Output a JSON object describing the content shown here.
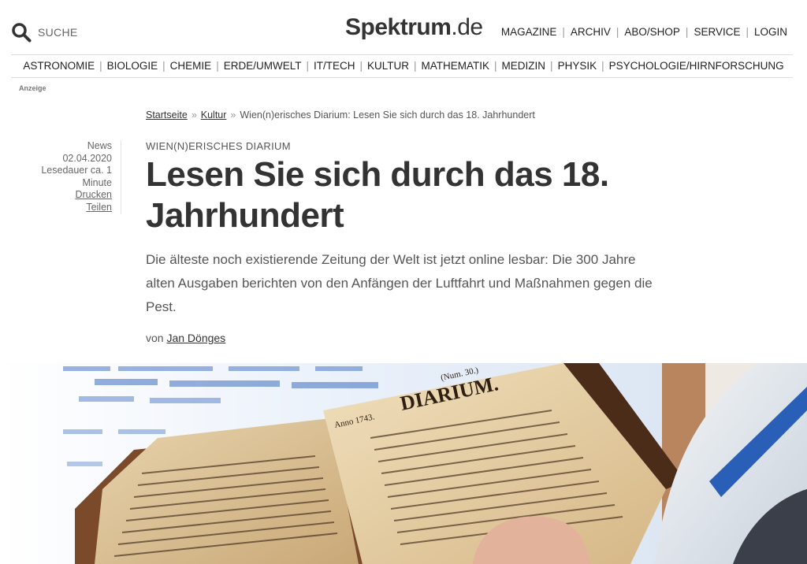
{
  "header": {
    "search_label": "SUCHE",
    "logo_main": "Spektrum",
    "logo_domain": ".de",
    "nav": [
      "MAGAZINE",
      "ARCHIV",
      "ABO/SHOP",
      "SERVICE",
      "LOGIN"
    ]
  },
  "categories": [
    "ASTRONOMIE",
    "BIOLOGIE",
    "CHEMIE",
    "ERDE/UMWELT",
    "IT/TECH",
    "KULTUR",
    "MATHEMATIK",
    "MEDIZIN",
    "PHYSIK",
    "PSYCHOLOGIE/HIRNFORSCHUNG"
  ],
  "ad_label": "Anzeige",
  "breadcrumb": {
    "home": "Startseite",
    "section": "Kultur",
    "current": "Wien(n)erisches Diarium: Lesen Sie sich durch das 18. Jahrhundert",
    "separator": "»"
  },
  "meta": {
    "type": "News",
    "date": "02.04.2020",
    "reading_time": "Lesedauer ca. 1 Minute",
    "print": "Drucken",
    "share": "Teilen"
  },
  "article": {
    "kicker": "WIEN(N)ERISCHES DIARIUM",
    "headline": "Lesen Sie sich durch das 18. Jahrhundert",
    "teaser": "Die älteste noch existierende Zeitung der Welt ist jetzt online lesbar: Die 300 Jahre alten Ausgaben berichten von den Anfängen der Luftfahrt und Maßnahmen gegen die Pest.",
    "byline_prefix": "von",
    "author": "Jan Dönges"
  },
  "hero": {
    "newspaper_masthead": "DIARIUM.",
    "issue": "(Num. 30.)",
    "year": "Anno 1743."
  },
  "colors": {
    "text": "#333333",
    "muted": "#666666",
    "rule": "#dddddd"
  }
}
